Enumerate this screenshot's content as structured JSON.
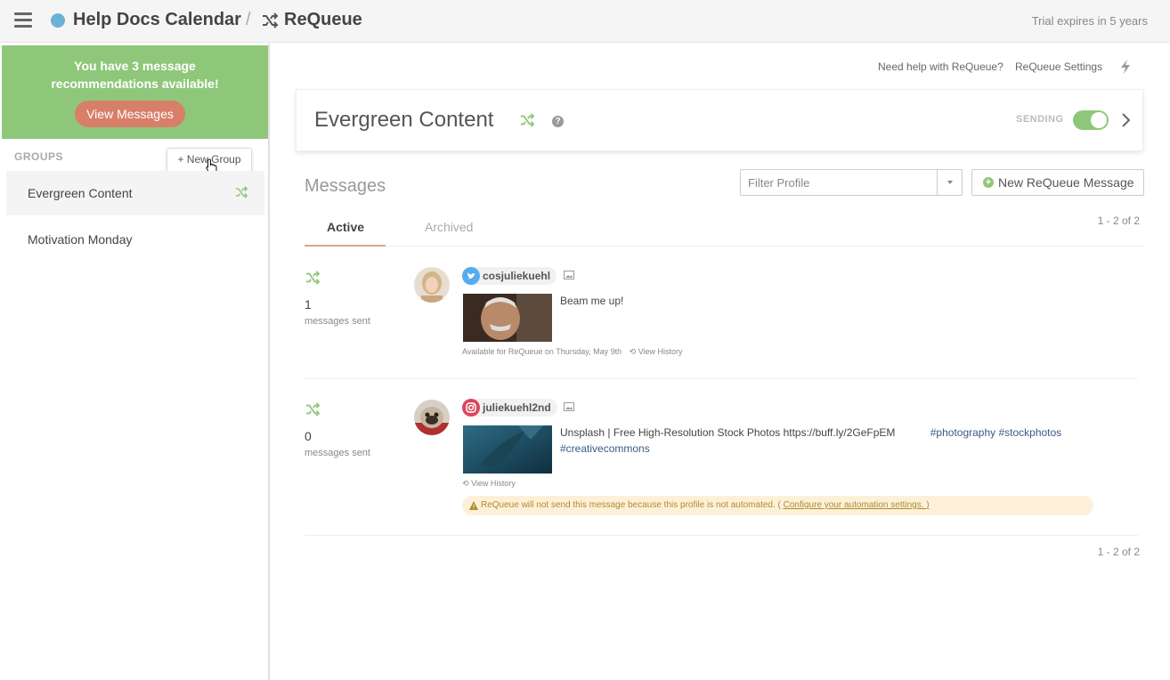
{
  "topbar": {
    "app_title": "Help Docs Calendar",
    "separator": "/",
    "section_title": "ReQueue",
    "trial_text": "Trial expires in 5 years"
  },
  "sidebar": {
    "recommendation_text": "You have 3 message recommendations available!",
    "view_messages_label": "View Messages",
    "groups_label": "GROUPS",
    "new_group_label": "+ New Group",
    "groups": [
      {
        "label": "Evergreen Content",
        "active": true,
        "icon": "shuffle-icon"
      },
      {
        "label": "Motivation Monday",
        "active": false
      }
    ]
  },
  "main": {
    "help_link": "Need help with ReQueue?",
    "settings_link": "ReQueue Settings",
    "group_title": "Evergreen Content",
    "sending_label": "SENDING",
    "sending_on": true,
    "messages_title": "Messages",
    "filter_placeholder": "Filter Profile",
    "new_message_label": "New ReQueue Message",
    "pager_top": "1 - 2 of 2",
    "pager_bottom": "1 - 2 of 2",
    "tabs": [
      {
        "label": "Active",
        "active": true
      },
      {
        "label": "Archived",
        "active": false
      }
    ],
    "messages": [
      {
        "count": "1",
        "count_label": "messages sent",
        "network": "twitter",
        "handle": "cosjuliekuehl",
        "text": "Beam me up!",
        "available_text": "Available for ReQueue on Thursday, May 9th",
        "history_label": "View History"
      },
      {
        "count": "0",
        "count_label": "messages sent",
        "network": "instagram",
        "handle": "juliekuehl2nd",
        "text": "Unsplash | Free High-Resolution Stock Photos https://buff.ly/2GeFpEM",
        "tags_line1": "#photography #stockphotos",
        "tags_line2": "#creativecommons",
        "history_label": "View History",
        "warning_text": "ReQueue will not send this message because this profile is not automated. (",
        "warning_link": "Configure your automation settings. )"
      }
    ]
  },
  "colors": {
    "accent_green": "#8fc77a",
    "accent_coral": "#d87f6a",
    "twitter_blue": "#55acee",
    "instagram_red": "#d9465e",
    "warning_bg": "#fcf1d8"
  }
}
